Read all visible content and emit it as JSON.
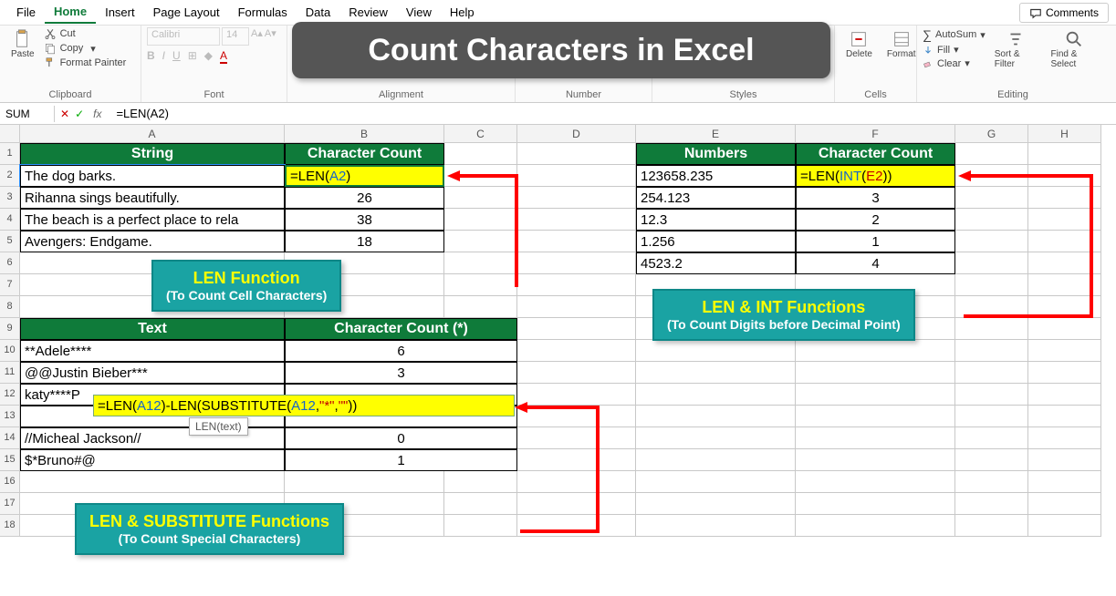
{
  "menu": {
    "items": [
      "File",
      "Home",
      "Insert",
      "Page Layout",
      "Formulas",
      "Data",
      "Review",
      "View",
      "Help"
    ],
    "active": "Home",
    "comments": "Comments"
  },
  "ribbon": {
    "clipboard": {
      "paste": "Paste",
      "cut": "Cut",
      "copy": "Copy",
      "painter": "Format Painter",
      "label": "Clipboard"
    },
    "font": {
      "family": "Calibri",
      "size": "14",
      "label": "Font"
    },
    "alignment": {
      "label": "Alignment"
    },
    "number": {
      "label": "Number"
    },
    "styles": {
      "label": "Styles"
    },
    "cells": {
      "delete": "Delete",
      "format": "Format",
      "label": "Cells"
    },
    "editing": {
      "autosum": "AutoSum",
      "fill": "Fill",
      "clear": "Clear",
      "sort": "Sort & Filter",
      "find": "Find & Select",
      "label": "Editing"
    }
  },
  "formulabar": {
    "name": "SUM",
    "cancel": "✕",
    "enter": "✓",
    "fx": "fx",
    "formula": "=LEN(A2)"
  },
  "columns": [
    "A",
    "B",
    "C",
    "D",
    "E",
    "F",
    "G",
    "H"
  ],
  "tables": {
    "t1": {
      "h1": "String",
      "h2": "Character Count",
      "rows": [
        {
          "a": "The dog barks.",
          "b": "=LEN(A2)"
        },
        {
          "a": "Rihanna sings beautifully.",
          "b": "26"
        },
        {
          "a": "The beach is a perfect place to rela",
          "b": "38"
        },
        {
          "a": "Avengers: Endgame.",
          "b": "18"
        }
      ]
    },
    "t2": {
      "h1": "Text",
      "h2": "Character Count (*)",
      "rows": [
        {
          "a": "**Adele****",
          "b": "6"
        },
        {
          "a": " @@Justin Bieber***",
          "b": "3"
        },
        {
          "a": "katy****P",
          "formula": "=LEN(A12)-LEN(SUBSTITUTE(A12,\"*\",\"\"))"
        },
        {
          "a": "//Micheal Jackson//",
          "b": "0"
        },
        {
          "a": "$*Bruno#@",
          "b": "1"
        }
      ]
    },
    "t3": {
      "h1": "Numbers",
      "h2": "Character Count",
      "rows": [
        {
          "a": "123658.235",
          "b": "=LEN(INT(E2))"
        },
        {
          "a": "254.123",
          "b": "3"
        },
        {
          "a": "12.3",
          "b": "2"
        },
        {
          "a": "1.256",
          "b": "1"
        },
        {
          "a": "4523.2",
          "b": "4"
        }
      ]
    }
  },
  "callouts": {
    "c1": {
      "t1": "LEN Function",
      "t2": "(To Count Cell Characters)"
    },
    "c2": {
      "t1": "LEN & INT Functions",
      "t2": "(To Count Digits before Decimal Point)"
    },
    "c3": {
      "t1": "LEN & SUBSTITUTE Functions",
      "t2": "(To Count Special Characters)"
    }
  },
  "title": "Count Characters in Excel",
  "tooltip": "LEN(text)"
}
